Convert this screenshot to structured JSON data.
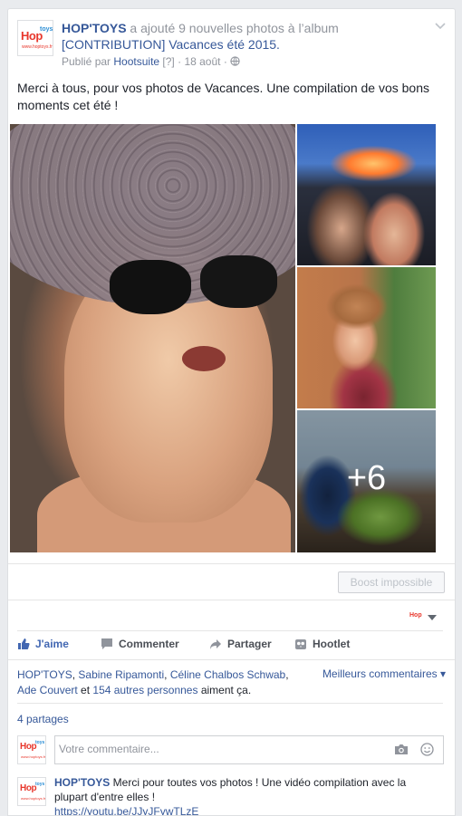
{
  "post": {
    "page_name": "HOP'TOYS",
    "action_text": " a ajouté 9 nouvelles photos à l’album ",
    "album_title": "[CONTRIBUTION] Vacances été 2015.",
    "published_by_label": "Publié par ",
    "publisher": "Hootsuite",
    "help_marker": "[?]",
    "dot": " · ",
    "date": "18 août",
    "dot2": " · ",
    "privacy_icon": "globe-icon",
    "message": "Merci à tous, pour vos photos de Vacances. Une compilation de vos bons moments cet été !",
    "more_photos_badge": "+6"
  },
  "logo": {
    "word": "Hop",
    "word2": "toys",
    "site": "www.hoptoys.fr"
  },
  "boost_button": "Boost impossible",
  "actions": {
    "like": "J'aime",
    "comment": "Commenter",
    "share": "Partager",
    "hootlet": "Hootlet"
  },
  "likes": {
    "names": [
      "HOP'TOYS",
      "Sabine Ripamonti",
      "Céline Chalbos Schwab",
      "Ade Couvert"
    ],
    "sep1": ", ",
    "sep2": ", ",
    "sep3": ", ",
    "and": " et ",
    "others": "154 autres personnes",
    "suffix": " aiment ça."
  },
  "best_comments": "Meilleurs commentaires ▾",
  "shares": "4 partages",
  "comment_input": {
    "placeholder": "Votre commentaire..."
  },
  "comment": {
    "author": "HOP'TOYS",
    "text": " Merci pour toutes vos photos ! Une vidéo compilation avec la plupart d'entre elles !",
    "link": "https://youtu.be/JJyJFywTLzE"
  },
  "colors": {
    "link": "#365899",
    "like_blue": "#4267b2",
    "brand_red": "#e8372c"
  }
}
